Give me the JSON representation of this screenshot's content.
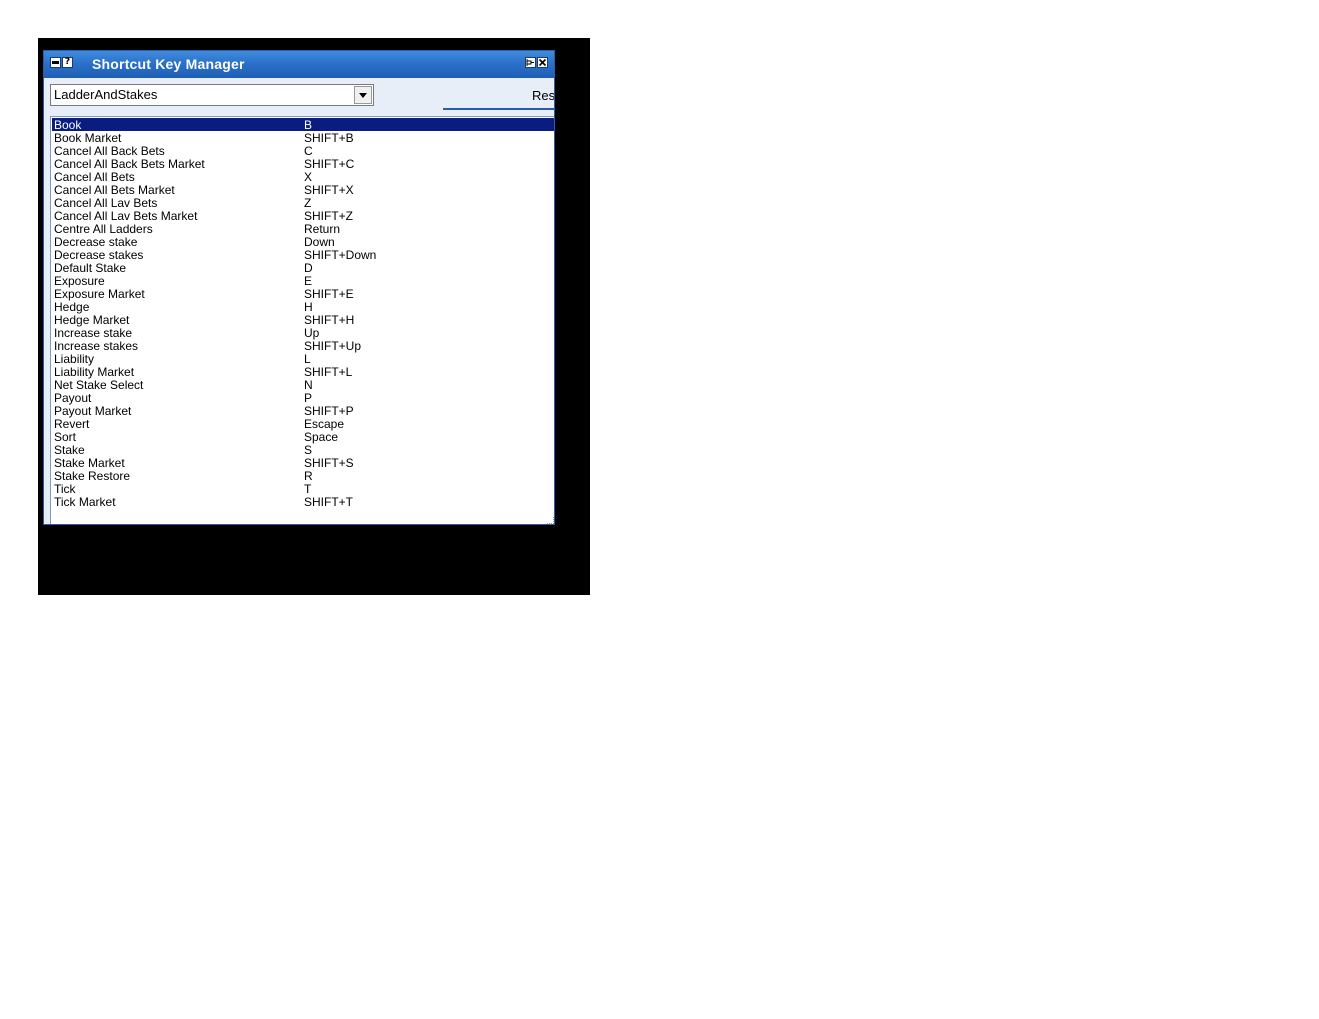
{
  "window": {
    "title": "Shortcut Key Manager",
    "help_glyph": "?"
  },
  "dropdown": {
    "value": "LadderAndStakes"
  },
  "reset_button": {
    "label": "Res"
  },
  "shortcuts": [
    {
      "name": "Book",
      "key": "B",
      "selected": true
    },
    {
      "name": "Book Market",
      "key": "SHIFT+B"
    },
    {
      "name": "Cancel All Back Bets",
      "key": "C"
    },
    {
      "name": "Cancel All Back Bets Market",
      "key": "SHIFT+C"
    },
    {
      "name": "Cancel All Bets",
      "key": "X"
    },
    {
      "name": "Cancel All Bets Market",
      "key": "SHIFT+X"
    },
    {
      "name": "Cancel All Lav Bets",
      "key": "Z"
    },
    {
      "name": "Cancel All Lav Bets Market",
      "key": "SHIFT+Z"
    },
    {
      "name": "Centre All Ladders",
      "key": "Return"
    },
    {
      "name": "Decrease stake",
      "key": "Down"
    },
    {
      "name": "Decrease stakes",
      "key": "SHIFT+Down"
    },
    {
      "name": "Default Stake",
      "key": "D"
    },
    {
      "name": "Exposure",
      "key": "E"
    },
    {
      "name": "Exposure Market",
      "key": "SHIFT+E"
    },
    {
      "name": "Hedge",
      "key": "H"
    },
    {
      "name": "Hedge Market",
      "key": "SHIFT+H"
    },
    {
      "name": "Increase stake",
      "key": "Up"
    },
    {
      "name": "Increase stakes",
      "key": "SHIFT+Up"
    },
    {
      "name": "Liability",
      "key": "L"
    },
    {
      "name": "Liability Market",
      "key": "SHIFT+L"
    },
    {
      "name": "Net Stake Select",
      "key": "N"
    },
    {
      "name": "Payout",
      "key": "P"
    },
    {
      "name": "Payout Market",
      "key": "SHIFT+P"
    },
    {
      "name": "Revert",
      "key": "Escape"
    },
    {
      "name": "Sort",
      "key": "Space"
    },
    {
      "name": "Stake",
      "key": "S"
    },
    {
      "name": "Stake Market",
      "key": "SHIFT+S"
    },
    {
      "name": "Stake Restore",
      "key": "R"
    },
    {
      "name": "Tick",
      "key": "T"
    },
    {
      "name": "Tick Market",
      "key": "SHIFT+T"
    }
  ],
  "colors": {
    "titlebar": "#2a6fc7",
    "selection": "#0a1c7f",
    "window_bg": "#e7eef7"
  },
  "icons": [
    "menu-icon",
    "help-icon",
    "pin-icon",
    "close-icon",
    "dropdown-arrow-icon"
  ]
}
